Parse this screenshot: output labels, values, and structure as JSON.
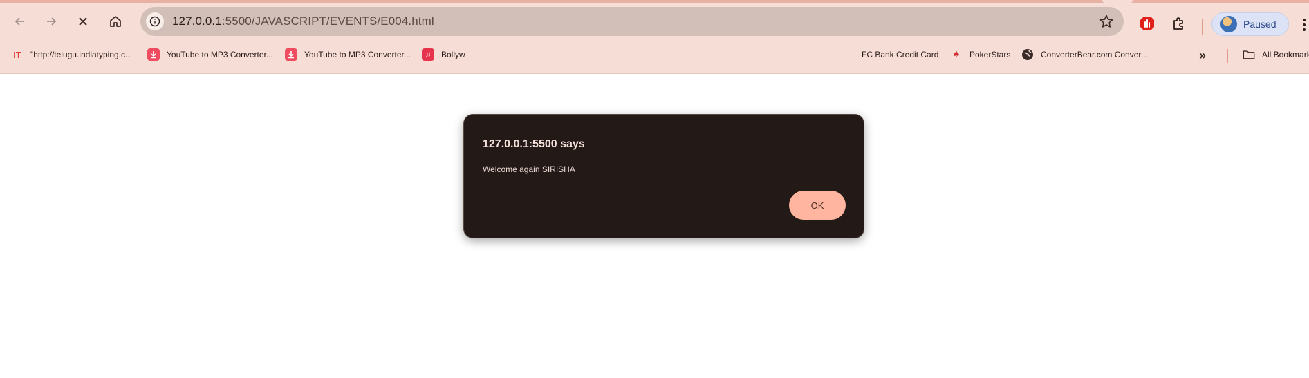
{
  "browser": {
    "url_host": "127.0.0.1",
    "url_path": ":5500/JAVASCRIPT/EVENTS/E004.html",
    "profile_label": "Paused",
    "icons": {
      "back": "arrow-left-icon",
      "forward": "arrow-right-icon",
      "stop": "close-icon",
      "home": "home-icon",
      "info": "info-icon",
      "star": "star-icon",
      "extension_red": "stop-hand-icon",
      "extensions": "puzzle-icon",
      "menu": "kebab-menu-icon"
    }
  },
  "bookmarks": {
    "items": [
      {
        "label": "\"http://telugu.indiatyping.c...",
        "icon": "IT",
        "color": "#e53935"
      },
      {
        "label": "YouTube to MP3 Converter...",
        "icon": "download-icon",
        "color": "#ef4d5f"
      },
      {
        "label": "YouTube to MP3 Converter...",
        "icon": "download-icon",
        "color": "#ef4d5f"
      },
      {
        "label": "Bollyw",
        "icon": "music-icon",
        "color": "#e6344c"
      },
      {
        "label": "FC Bank Credit Card",
        "icon": "",
        "color": ""
      },
      {
        "label": "PokerStars",
        "icon": "spade-icon",
        "color": "#d32f2f"
      },
      {
        "label": "ConverterBear.com Conver...",
        "icon": "globe-icon",
        "color": "#3a2a27"
      }
    ],
    "overflow_label": "»",
    "all_bookmarks_label": "All Bookmarks"
  },
  "dialog": {
    "title": "127.0.0.1:5500 says",
    "message": "Welcome again SIRISHA",
    "ok_label": "OK"
  },
  "colors": {
    "chrome_bg": "#f6ddd6",
    "omnibox_bg": "#d2bfb8",
    "dialog_bg": "#231917",
    "ok_button": "#ffb59f"
  }
}
